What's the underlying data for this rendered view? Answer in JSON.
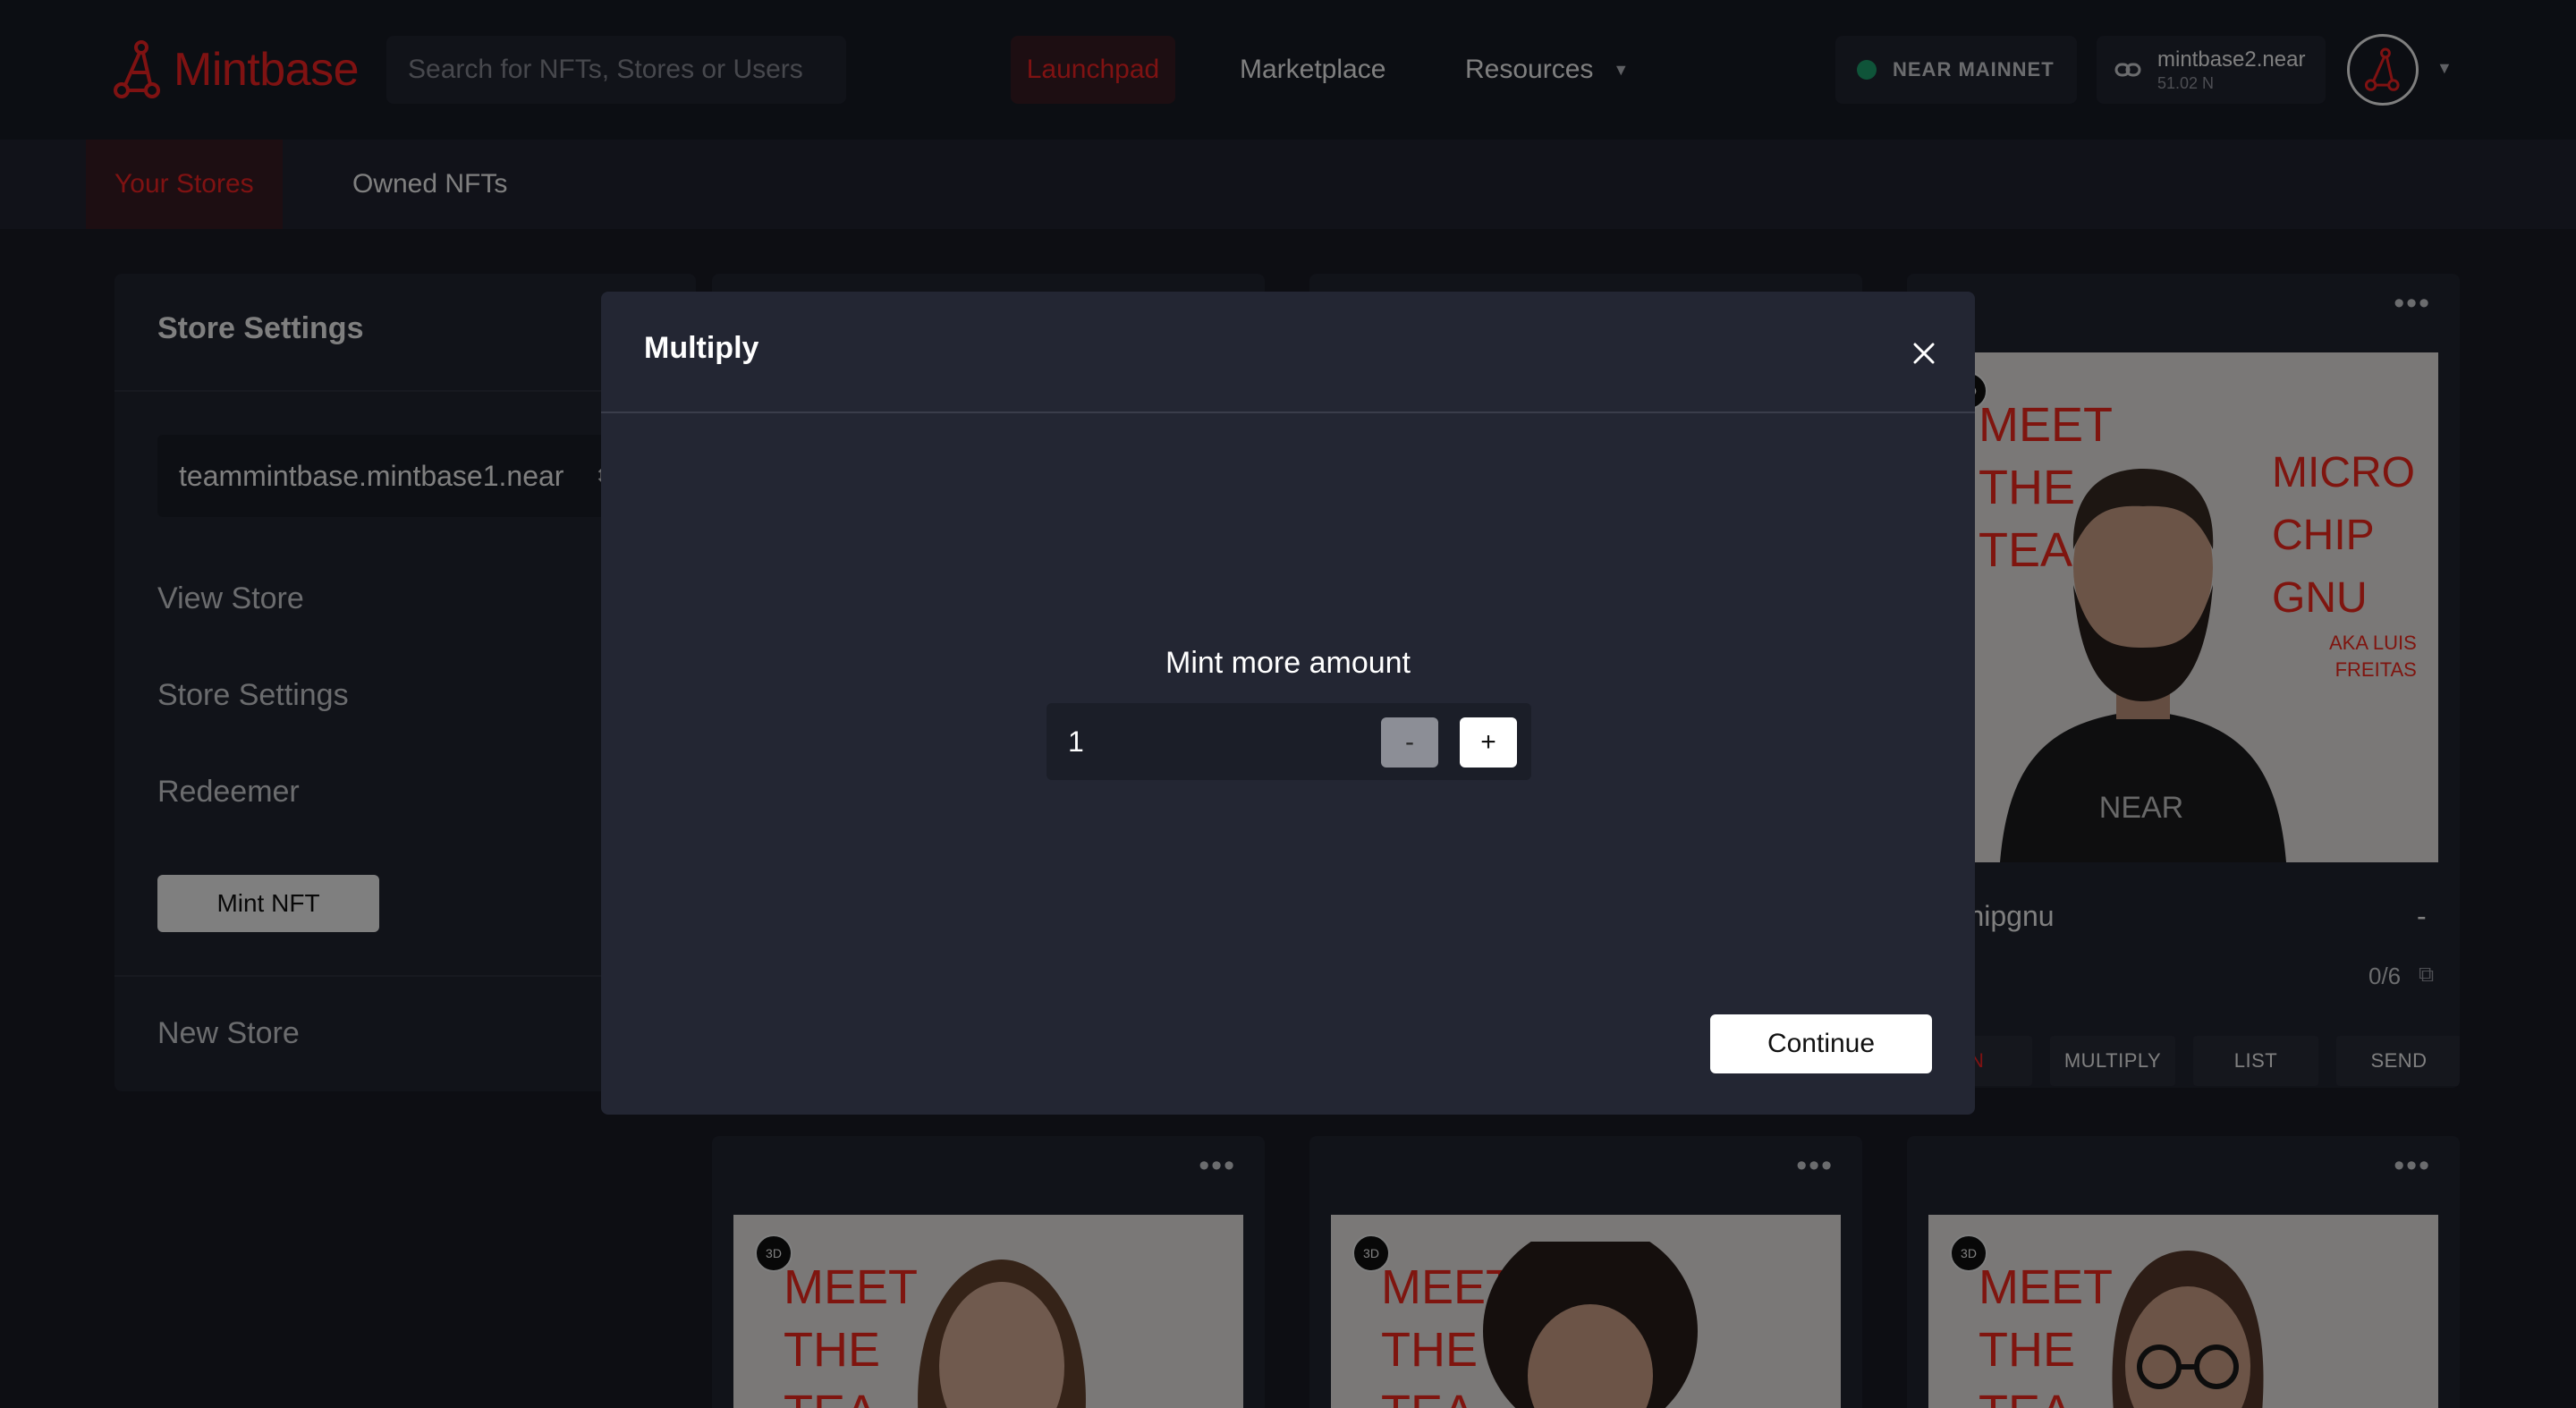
{
  "header": {
    "logo_text": "Mintbase",
    "search_placeholder": "Search for NFTs, Stores or Users",
    "nav": {
      "launchpad": "Launchpad",
      "marketplace": "Marketplace",
      "resources": "Resources"
    },
    "network": "NEAR MAINNET",
    "account": {
      "name": "mintbase2.near",
      "balance": "51.02 N"
    }
  },
  "subnav": {
    "tabs": [
      "Your Stores",
      "Owned NFTs"
    ],
    "active_tab": "Your Stores"
  },
  "sidebar": {
    "title": "Store Settings",
    "store_selected": "teammintbase.mintbase1.near",
    "links": [
      "View Store",
      "Store Settings",
      "Redeemer"
    ],
    "mint_button": "Mint NFT",
    "new_store": "New Store"
  },
  "cards": [
    {
      "art": {
        "headline": "MEET\nTHE\nTEAM",
        "name_text": "MICRO\nCHIP\nGNU",
        "aka_text": "AKA LUIS\nFREITAS",
        "shirt_text": "NEAR",
        "badge": "3D"
      },
      "name": "rochipgnu",
      "price": "-",
      "count": "0/6",
      "actions": [
        "RN",
        "MULTIPLY",
        "LIST",
        "SEND"
      ]
    },
    {
      "art": {
        "headline": "MEET\nTHE\nTEA",
        "badge": "3D"
      }
    },
    {
      "art": {
        "headline": "MEET\nTHE\nTEA",
        "badge": "3D"
      }
    },
    {
      "art": {
        "headline": "MEET\nTHE\nTEA",
        "badge": "3D"
      }
    }
  ],
  "modal": {
    "title": "Multiply",
    "amount_label": "Mint more amount",
    "amount_value": "1",
    "minus_label": "-",
    "plus_label": "+",
    "continue_label": "Continue"
  },
  "colors": {
    "brand_red": "#ff2424",
    "network_green": "#1fa872",
    "background": "#1a1d27",
    "panel": "#232633"
  }
}
